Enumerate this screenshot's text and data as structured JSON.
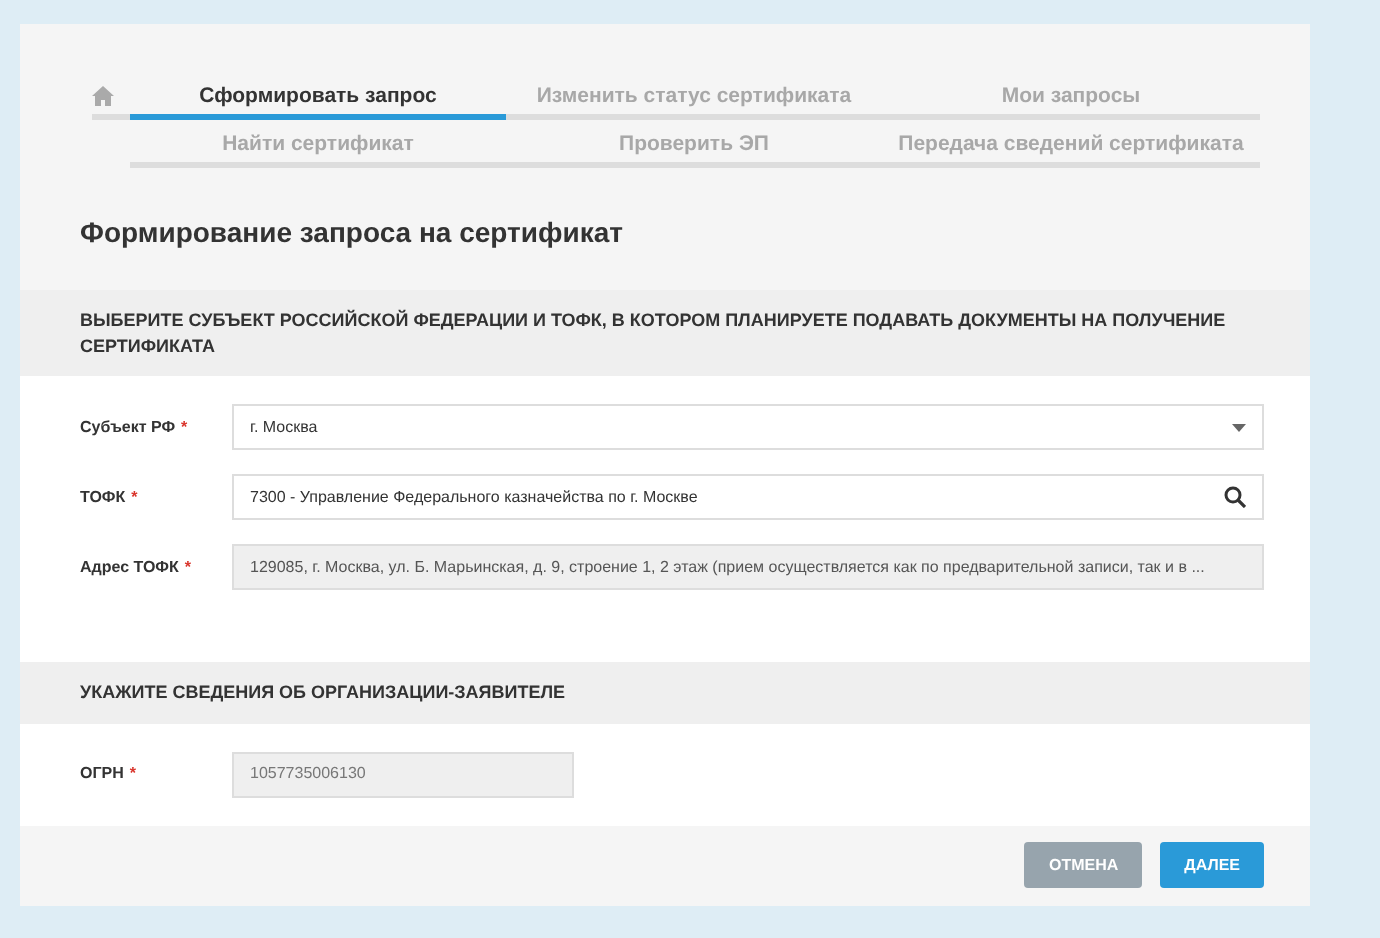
{
  "tabs": [
    {
      "label": "Сформировать запрос",
      "selected": true
    },
    {
      "label": "Изменить статус сертификата",
      "selected": false
    },
    {
      "label": "Мои запросы",
      "selected": false
    },
    {
      "label": "Найти сертификат",
      "selected": false
    },
    {
      "label": "Проверить ЭП",
      "selected": false
    },
    {
      "label": "Передача сведений сертификата",
      "selected": false
    }
  ],
  "title": "Формирование запроса на сертификат",
  "sections": [
    {
      "heading": "ВЫБЕРИТЕ СУБЪЕКТ РОССИЙСКОЙ ФЕДЕРАЦИИ И ТОФК, В КОТОРОМ ПЛАНИРУЕТЕ ПОДАВАТЬ ДОКУМЕНТЫ НА ПОЛУЧЕНИЕ СЕРТИФИКАТА",
      "fields": [
        {
          "label": "Субъект РФ",
          "required_mark": "*",
          "kind": "select",
          "value": "г. Москва",
          "wide": true
        },
        {
          "label": "ТОФК",
          "required_mark": "*",
          "kind": "search",
          "value": "7300 - Управление Федерального казначейства по г. Москве",
          "wide": true
        },
        {
          "label": "Адрес ТОФК",
          "required_mark": "*",
          "kind": "readonly",
          "value": "129085, г. Москва, ул. Б. Марьинская, д. 9, строение 1, 2 этаж (прием осуществляется как по предварительной записи, так и в ...",
          "wide": true
        }
      ]
    },
    {
      "heading": "УКАЖИТЕ СВЕДЕНИЯ ОБ ОРГАНИЗАЦИИ-ЗАЯВИТЕЛЕ",
      "fields": [
        {
          "label": "ОГРН",
          "required_mark": "*",
          "kind": "readonly",
          "value": "1057735006130",
          "wide": false
        }
      ]
    }
  ],
  "buttons": [
    {
      "label": "ОТМЕНА",
      "kind": "secondary"
    },
    {
      "label": "ДАЛЕЕ",
      "kind": "primary"
    }
  ]
}
